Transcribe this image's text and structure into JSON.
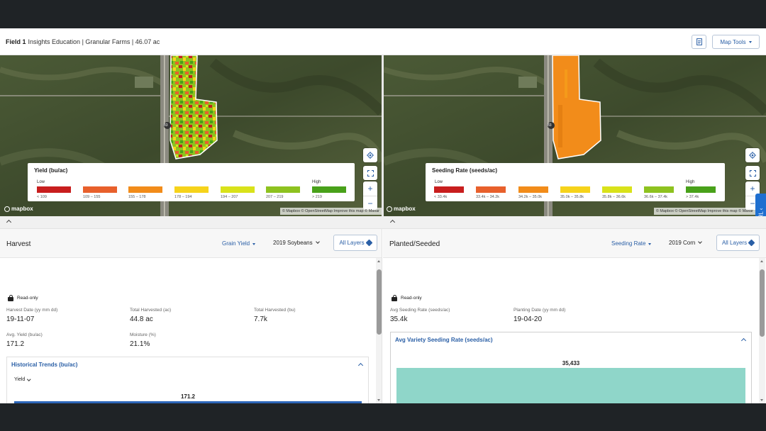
{
  "header": {
    "field_name": "Field 1",
    "details": "Insights Education | Granular Farms | 46.07 ac",
    "map_tools_label": "Map Tools",
    "doc_icon": "document-icon"
  },
  "maps": {
    "left": {
      "legend_title": "Yield (bu/ac)",
      "low_label": "Low",
      "high_label": "High",
      "bins": [
        {
          "label": "< 109",
          "color": "#c81e1e"
        },
        {
          "label": "109 – 155",
          "color": "#e8602c"
        },
        {
          "label": "155 – 178",
          "color": "#f28c1a"
        },
        {
          "label": "178 – 194",
          "color": "#f6d31b"
        },
        {
          "label": "194 – 207",
          "color": "#d9e21a"
        },
        {
          "label": "207 – 219",
          "color": "#8ec21f"
        },
        {
          "label": "> 219",
          "color": "#49a11a"
        }
      ],
      "attribution": "© Mapbox © OpenStreetMap  Improve this map © Maxar"
    },
    "right": {
      "legend_title": "Seeding Rate (seeds/ac)",
      "low_label": "Low",
      "high_label": "High",
      "bins": [
        {
          "label": "< 33.4k",
          "color": "#c81e1e"
        },
        {
          "label": "33.4k – 34.2k",
          "color": "#e8602c"
        },
        {
          "label": "34.2k – 35.0k",
          "color": "#f28c1a"
        },
        {
          "label": "35.0k – 35.8k",
          "color": "#f6d31b"
        },
        {
          "label": "35.8k – 36.6k",
          "color": "#d9e21a"
        },
        {
          "label": "36.6k – 37.4k",
          "color": "#8ec21f"
        },
        {
          "label": "> 37.4k",
          "color": "#49a11a"
        }
      ],
      "attribution": "© Mapbox © OpenStreetMap  Improve this map © Maxar"
    },
    "mapbox_label": "mapbox",
    "zoom_in": "+",
    "zoom_out": "−",
    "highway_label": "83"
  },
  "carl_tab": "CARL ‹",
  "harvest": {
    "title": "Harvest",
    "metric_select": "Grain Yield",
    "season_select": "2019 Soybeans",
    "layers_label": "All Layers",
    "read_only": "Read-only",
    "stats": [
      {
        "label": "Harvest Date (yy mm dd)",
        "value": "19-11-07"
      },
      {
        "label": "Total Harvested (ac)",
        "value": "44.8 ac"
      },
      {
        "label": "Total Harvested (bu)",
        "value": "7.7k"
      },
      {
        "label": "Avg. Yield (bu/ac)",
        "value": "171.2"
      },
      {
        "label": "Moisture (%)",
        "value": "21.1%"
      }
    ],
    "trends_title": "Historical Trends (bu/ac)",
    "trends_select": "Yield"
  },
  "planted": {
    "title": "Planted/Seeded",
    "metric_select": "Seeding Rate",
    "season_select": "2019 Corn",
    "layers_label": "All Layers",
    "read_only": "Read-only",
    "stats": [
      {
        "label": "Avg Seeding Rate (seeds/ac)",
        "value": "35.4k"
      },
      {
        "label": "Planting Date (yy mm dd)",
        "value": "19-04-20"
      }
    ],
    "variety_title": "Avg Variety Seeding Rate (seeds/ac)"
  },
  "chart_data": [
    {
      "type": "bar",
      "title": "Historical Trends (bu/ac)",
      "categories": [
        ""
      ],
      "values": [
        171.2
      ],
      "data_labels": [
        "171.2"
      ],
      "color": "#2d66b9"
    },
    {
      "type": "bar",
      "title": "Avg Variety Seeding Rate (seeds/ac)",
      "categories": [
        ""
      ],
      "values": [
        35433
      ],
      "data_labels": [
        "35,433"
      ],
      "color": "#8fd6c9"
    }
  ]
}
